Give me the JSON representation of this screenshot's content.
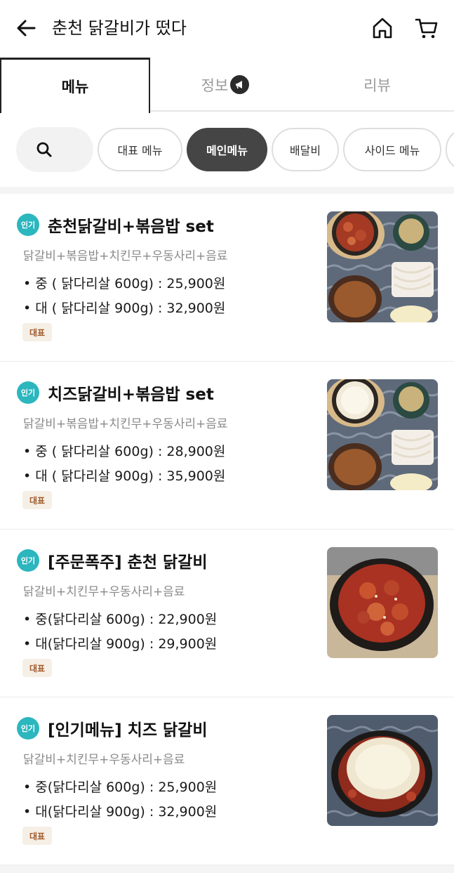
{
  "header": {
    "title": "춘천 닭갈비가 떴다",
    "back_icon": "arrow-left-icon",
    "home_icon": "home-icon",
    "cart_icon": "cart-icon"
  },
  "tabs": [
    {
      "label": "메뉴",
      "active": true
    },
    {
      "label": "정보",
      "active": false,
      "icon": "megaphone-icon"
    },
    {
      "label": "리뷰",
      "active": false
    }
  ],
  "chips": {
    "search_icon": "search-icon",
    "items": [
      {
        "label": "대표 메뉴",
        "active": false
      },
      {
        "label": "메인메뉴",
        "active": true
      },
      {
        "label": "배달비",
        "active": false
      },
      {
        "label": "사이드 메뉴",
        "active": false
      }
    ]
  },
  "colors": {
    "popular_badge": "#2cb6be",
    "active_chip": "#454545",
    "tag_bg": "#f6efe6",
    "tag_text": "#a05a2c"
  },
  "menu": [
    {
      "badge": "인기",
      "name": "춘천닭갈비+볶음밥 set",
      "desc": "닭갈비+볶음밥+치킨무+우동사리+음료",
      "price1": "• 중 ( 닭다리살 600g) : 25,900원",
      "price2": "• 대 ( 닭다리살 900g) : 32,900원",
      "tag": "대표"
    },
    {
      "badge": "인기",
      "name": "치즈닭갈비+볶음밥 set",
      "desc": "닭갈비+볶음밥+치킨무+우동사리+음료",
      "price1": "• 중 ( 닭다리살 600g) : 28,900원",
      "price2": "• 대 ( 닭다리살 900g) : 35,900원",
      "tag": "대표"
    },
    {
      "badge": "인기",
      "name": "[주문폭주] 춘천 닭갈비",
      "desc": "닭갈비+치킨무+우동사리+음료",
      "price1": "• 중(닭다리살 600g) : 22,900원",
      "price2": "• 대(닭다리살 900g) : 29,900원",
      "tag": "대표"
    },
    {
      "badge": "인기",
      "name": "[인기메뉴] 치즈 닭갈비",
      "desc": "닭갈비+치킨무+우동사리+음료",
      "price1": "• 중(닭다리살 600g) : 25,900원",
      "price2": "• 대(닭다리살 900g) : 32,900원",
      "tag": "대표"
    }
  ]
}
